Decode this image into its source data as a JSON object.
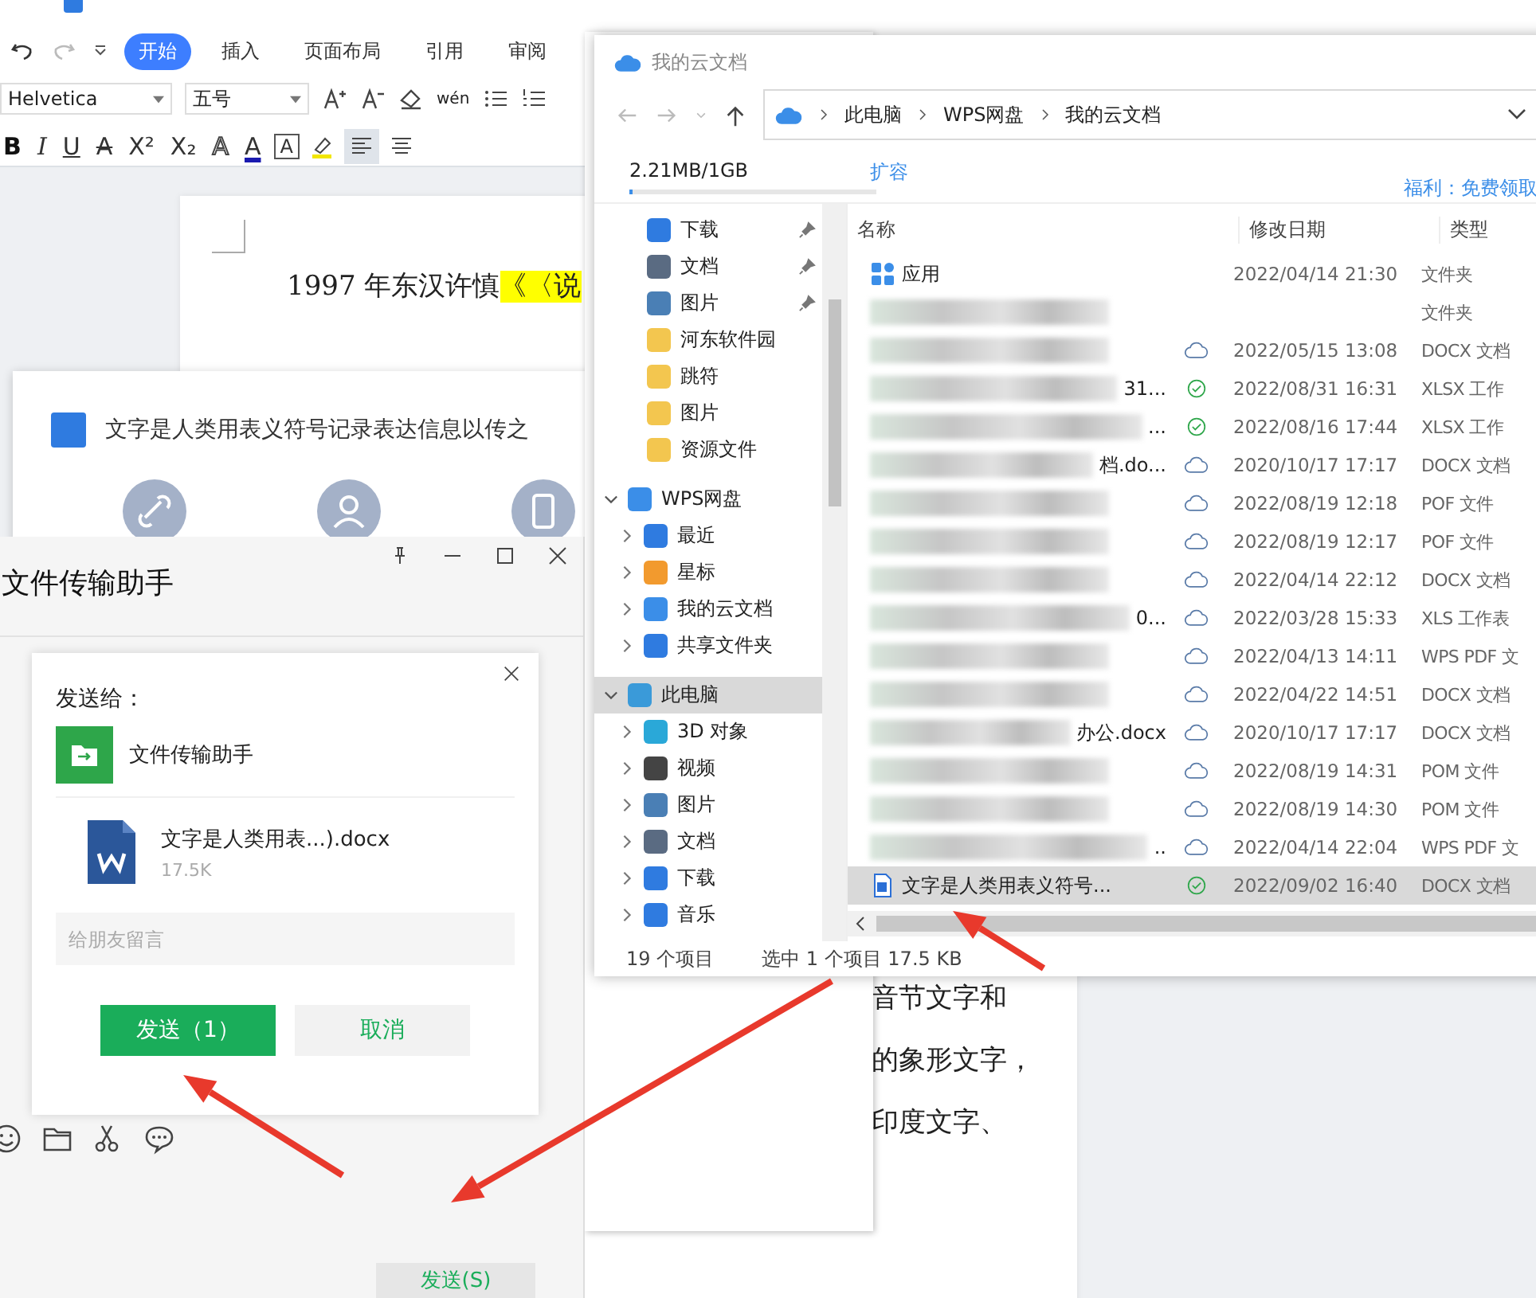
{
  "wps": {
    "ribbon_tabs": [
      {
        "label": "开始",
        "selected": true
      },
      {
        "label": "插入",
        "selected": false
      },
      {
        "label": "页面布局",
        "selected": false
      },
      {
        "label": "引用",
        "selected": false
      },
      {
        "label": "审阅",
        "selected": false
      }
    ],
    "font_name": "Helvetica",
    "font_size": "五号",
    "phonetic": "wén",
    "format_buttons": [
      {
        "label": "B",
        "kind": "bold"
      },
      {
        "label": "I",
        "kind": "italic"
      },
      {
        "label": "U",
        "kind": "underline"
      },
      {
        "label": "A",
        "kind": "strike"
      },
      {
        "label": "X²",
        "kind": "plain"
      },
      {
        "label": "X₂",
        "kind": "plain"
      },
      {
        "label": "A",
        "kind": "outline"
      },
      {
        "label": "A",
        "kind": "color"
      },
      {
        "label": "A",
        "kind": "boxed"
      }
    ]
  },
  "document": {
    "first_line": [
      {
        "text": "1997 年东汉许慎",
        "highlighted": false
      },
      {
        "text": "《〈说",
        "highlighted": true
      }
    ],
    "lower_lines": [
      "音节文字和",
      "的象形文字，",
      "印度文字、"
    ]
  },
  "share_panel": {
    "title": "文字是人类用表义符号记录表达信息以传之"
  },
  "chat_window": {
    "title": "文件传输助手",
    "send_button": "发送(S)",
    "dialog": {
      "heading": "发送给：",
      "recipient": "文件传输助手",
      "file_name": "文字是人类用表...).docx",
      "file_size": "17.5K",
      "placeholder": "给朋友留言",
      "send": "发送（1）",
      "cancel": "取消"
    }
  },
  "explorer": {
    "title": "我的云文档",
    "breadcrumb": [
      "此电脑",
      "WPS网盘",
      "我的云文档"
    ],
    "storage": {
      "text": "2.21MB/1GB",
      "level": 0.01,
      "expand_link": "扩容",
      "promo": "福利：免费领取"
    },
    "quick_access": [
      {
        "label": "下载",
        "kind": "download",
        "pinned": true
      },
      {
        "label": "文档",
        "kind": "document",
        "pinned": true
      },
      {
        "label": "图片",
        "kind": "picture",
        "pinned": true
      },
      {
        "label": "河东软件园",
        "kind": "folder",
        "pinned": false
      },
      {
        "label": "跳符",
        "kind": "folder",
        "pinned": false
      },
      {
        "label": "图片",
        "kind": "folder",
        "pinned": false
      },
      {
        "label": "资源文件",
        "kind": "folder",
        "pinned": false
      }
    ],
    "tree": [
      {
        "label": "WPS网盘",
        "kind": "cloud",
        "expanded": true,
        "selected": false,
        "children": [
          {
            "label": "最近",
            "kind": "clock",
            "expanded": false,
            "selected": false
          },
          {
            "label": "星标",
            "kind": "star",
            "expanded": false,
            "selected": false
          },
          {
            "label": "我的云文档",
            "kind": "cloud",
            "expanded": false,
            "selected": false
          },
          {
            "label": "共享文件夹",
            "kind": "share",
            "expanded": false,
            "selected": false
          }
        ]
      },
      {
        "label": "此电脑",
        "kind": "pc",
        "expanded": true,
        "selected": true,
        "children": [
          {
            "label": "3D 对象",
            "kind": "cube",
            "expanded": false,
            "selected": false
          },
          {
            "label": "视频",
            "kind": "video",
            "expanded": false,
            "selected": false
          },
          {
            "label": "图片",
            "kind": "picture",
            "expanded": false,
            "selected": false
          },
          {
            "label": "文档",
            "kind": "document",
            "expanded": false,
            "selected": false
          },
          {
            "label": "下载",
            "kind": "download",
            "expanded": false,
            "selected": false
          },
          {
            "label": "音乐",
            "kind": "music",
            "expanded": false,
            "selected": false
          }
        ]
      }
    ],
    "columns": [
      "名称",
      "修改日期",
      "类型"
    ],
    "rows": [
      {
        "name": "应用",
        "kind": "app",
        "blurred": false,
        "sync_icon": false,
        "date": "2022/04/14 21:30",
        "type": "文件夹",
        "selected": false
      },
      {
        "kind": "blur",
        "blurred": true,
        "sync_icon": false,
        "type": "文件夹",
        "selected": false
      },
      {
        "kind": "blur",
        "blurred": true,
        "sync_icon": true,
        "synced": false,
        "date": "2022/05/15 13:08",
        "type": "DOCX 文档",
        "selected": false
      },
      {
        "name": "31...",
        "kind": "blur",
        "blurred": true,
        "sync_icon": true,
        "synced": true,
        "date": "2022/08/31 16:31",
        "type": "XLSX 工作",
        "selected": false
      },
      {
        "name": "...",
        "kind": "blur",
        "blurred": true,
        "sync_icon": true,
        "synced": true,
        "date": "2022/08/16 17:44",
        "type": "XLSX 工作",
        "selected": false
      },
      {
        "name": "档.do...",
        "kind": "blur",
        "blurred": true,
        "sync_icon": true,
        "synced": false,
        "date": "2020/10/17 17:17",
        "type": "DOCX 文档",
        "selected": false
      },
      {
        "kind": "blur",
        "blurred": true,
        "sync_icon": true,
        "synced": false,
        "date": "2022/08/19 12:18",
        "type": "POF 文件",
        "selected": false
      },
      {
        "kind": "blur",
        "blurred": true,
        "sync_icon": true,
        "synced": false,
        "date": "2022/08/19 12:17",
        "type": "POF 文件",
        "selected": false
      },
      {
        "kind": "blur",
        "blurred": true,
        "sync_icon": true,
        "synced": false,
        "date": "2022/04/14 22:12",
        "type": "DOCX 文档",
        "selected": false
      },
      {
        "name": "0...",
        "kind": "blur",
        "blurred": true,
        "sync_icon": true,
        "synced": false,
        "date": "2022/03/28 15:33",
        "type": "XLS 工作表",
        "selected": false
      },
      {
        "kind": "blur",
        "blurred": true,
        "sync_icon": true,
        "synced": false,
        "date": "2022/04/13 14:11",
        "type": "WPS PDF 文",
        "selected": false
      },
      {
        "kind": "blur",
        "blurred": true,
        "sync_icon": true,
        "synced": false,
        "date": "2022/04/22 14:51",
        "type": "DOCX 文档",
        "selected": false
      },
      {
        "name": "办公.docx",
        "kind": "blur",
        "blurred": true,
        "sync_icon": true,
        "synced": false,
        "date": "2020/10/17 17:17",
        "type": "DOCX 文档",
        "selected": false
      },
      {
        "kind": "blur",
        "blurred": true,
        "sync_icon": true,
        "synced": false,
        "date": "2022/08/19 14:31",
        "type": "POM 文件",
        "selected": false
      },
      {
        "kind": "blur",
        "blurred": true,
        "sync_icon": true,
        "synced": false,
        "date": "2022/08/19 14:30",
        "type": "POM 文件",
        "selected": false
      },
      {
        "name": "..",
        "kind": "blur",
        "blurred": true,
        "sync_icon": true,
        "synced": false,
        "date": "2022/04/14 22:04",
        "type": "WPS PDF 文",
        "selected": false
      },
      {
        "name": "文字是人类用表义符号...",
        "kind": "docx",
        "blurred": false,
        "sync_icon": true,
        "synced": true,
        "date": "2022/09/02 16:40",
        "type": "DOCX 文档",
        "selected": true
      }
    ],
    "status": {
      "count": "19 个项目",
      "selection": "选中 1 个项目 17.5 KB"
    }
  }
}
